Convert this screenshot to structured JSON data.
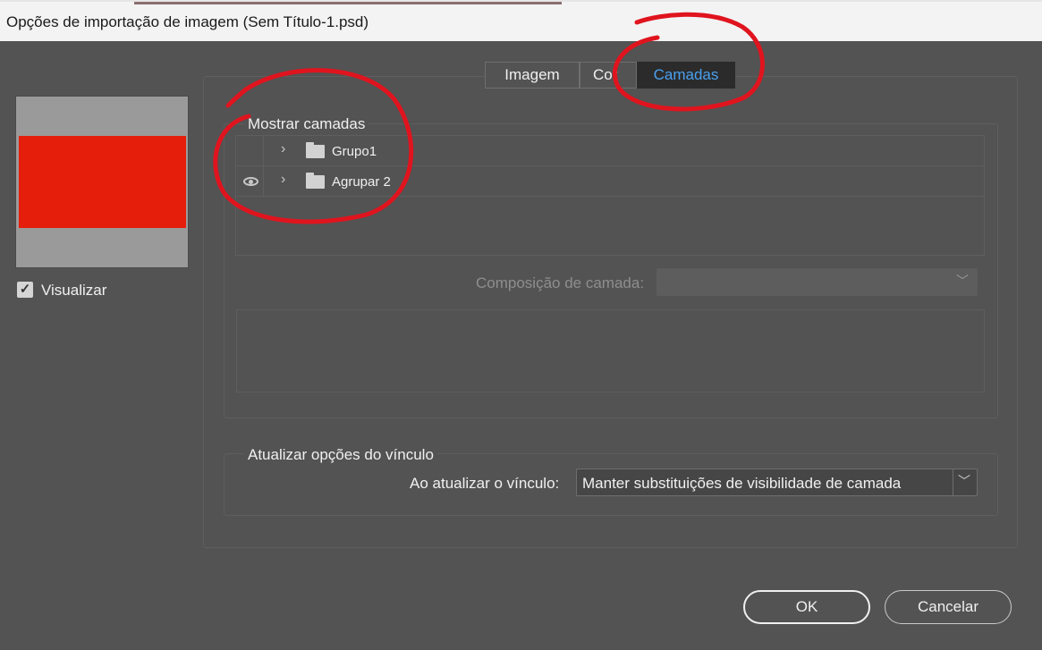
{
  "window": {
    "title": "Opções de importação de imagem (Sem Título-1.psd)"
  },
  "preview": {
    "checkbox_label": "Visualizar",
    "checked": true,
    "image_color": "#e51e0c"
  },
  "tabs": [
    {
      "label": "Imagem",
      "active": false
    },
    {
      "label": "Cor",
      "active": false
    },
    {
      "label": "Camadas",
      "active": true
    }
  ],
  "layers_section": {
    "title": "Mostrar camadas",
    "layers": [
      {
        "name": "Grupo1",
        "visible": false,
        "icon": "folder-icon"
      },
      {
        "name": "Agrupar 2",
        "visible": true,
        "icon": "folder-icon"
      }
    ],
    "comp_label": "Composição de camada:",
    "comp_value": ""
  },
  "link_section": {
    "title": "Atualizar opções do vínculo",
    "label": "Ao atualizar o vínculo:",
    "value": "Manter substituições de visibilidade de camada"
  },
  "buttons": {
    "ok": "OK",
    "cancel": "Cancelar"
  },
  "colors": {
    "accent": "#4aa0f0",
    "annotation": "#e0141e",
    "background": "#535353"
  }
}
